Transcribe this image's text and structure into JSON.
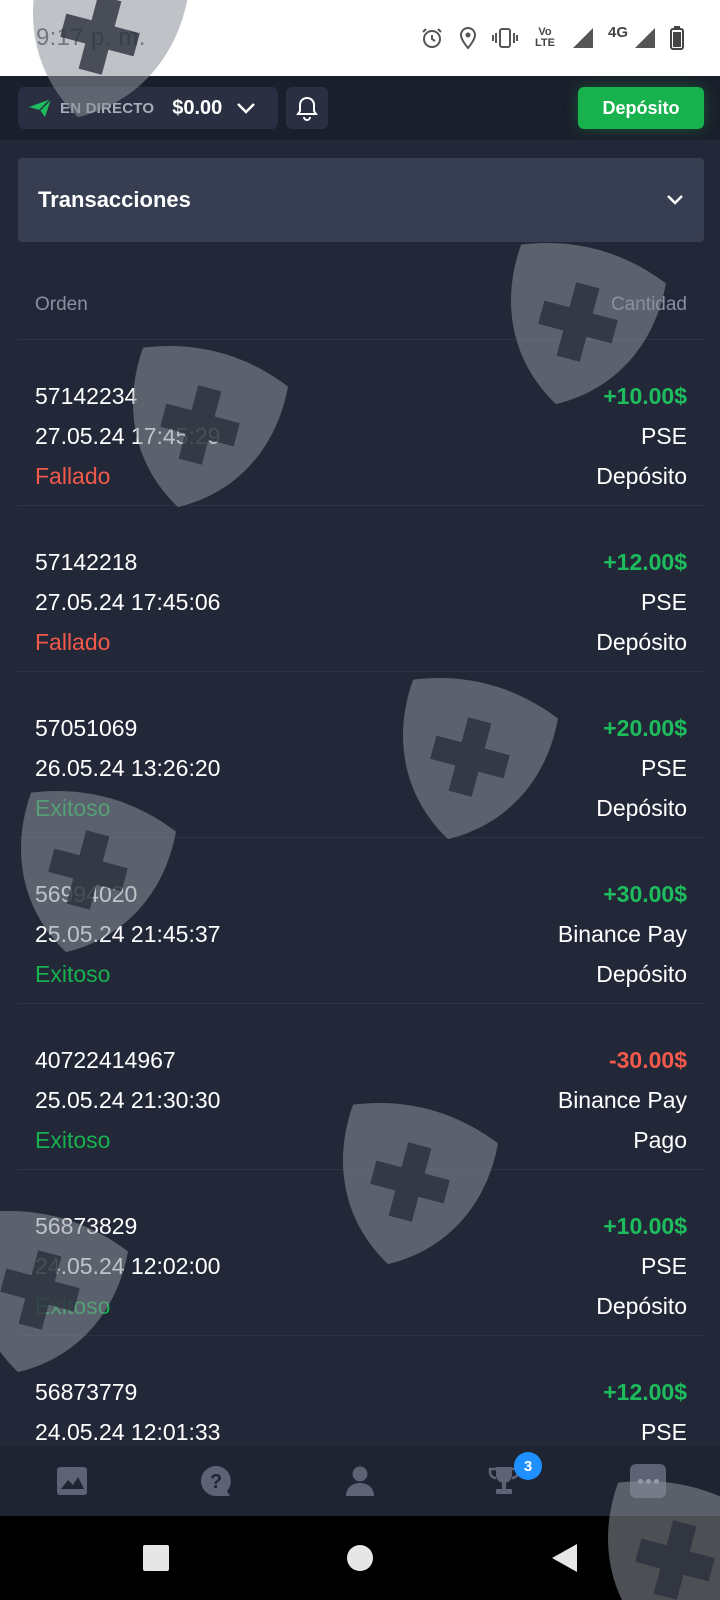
{
  "status_bar": {
    "time": "9:17 p. m.",
    "network_volte": "Vo LTE",
    "network_type": "4G"
  },
  "header": {
    "live_label": "EN DIRECTO",
    "balance": "$0.00",
    "deposit_label": "Depósito"
  },
  "section": {
    "title": "Transacciones"
  },
  "table": {
    "col_order": "Orden",
    "col_amount": "Cantidad",
    "rows": [
      {
        "id": "57142234",
        "datetime": "27.05.24 17:45:29",
        "status": "Fallado",
        "amount": "+10.00$",
        "method": "PSE",
        "type": "Depósito"
      },
      {
        "id": "57142218",
        "datetime": "27.05.24 17:45:06",
        "status": "Fallado",
        "amount": "+12.00$",
        "method": "PSE",
        "type": "Depósito"
      },
      {
        "id": "57051069",
        "datetime": "26.05.24 13:26:20",
        "status": "Exitoso",
        "amount": "+20.00$",
        "method": "PSE",
        "type": "Depósito"
      },
      {
        "id": "56994020",
        "datetime": "25.05.24 21:45:37",
        "status": "Exitoso",
        "amount": "+30.00$",
        "method": "Binance Pay",
        "type": "Depósito"
      },
      {
        "id": "40722414967",
        "datetime": "25.05.24 21:30:30",
        "status": "Exitoso",
        "amount": "-30.00$",
        "method": "Binance Pay",
        "type": "Pago"
      },
      {
        "id": "56873829",
        "datetime": "24.05.24 12:02:00",
        "status": "Exitoso",
        "amount": "+10.00$",
        "method": "PSE",
        "type": "Depósito"
      },
      {
        "id": "56873779",
        "datetime": "24.05.24 12:01:33",
        "status": "",
        "amount": "+12.00$",
        "method": "PSE",
        "type": ""
      }
    ]
  },
  "bottom_nav": {
    "items": [
      "chart-icon",
      "help-icon",
      "profile-icon",
      "trophy-icon",
      "more-icon"
    ],
    "trophy_badge": "3"
  },
  "colors": {
    "positive": "#1dbc5d",
    "negative": "#f2594b",
    "accent_green": "#17b14e",
    "badge_blue": "#1e90ff",
    "background": "#232838"
  }
}
